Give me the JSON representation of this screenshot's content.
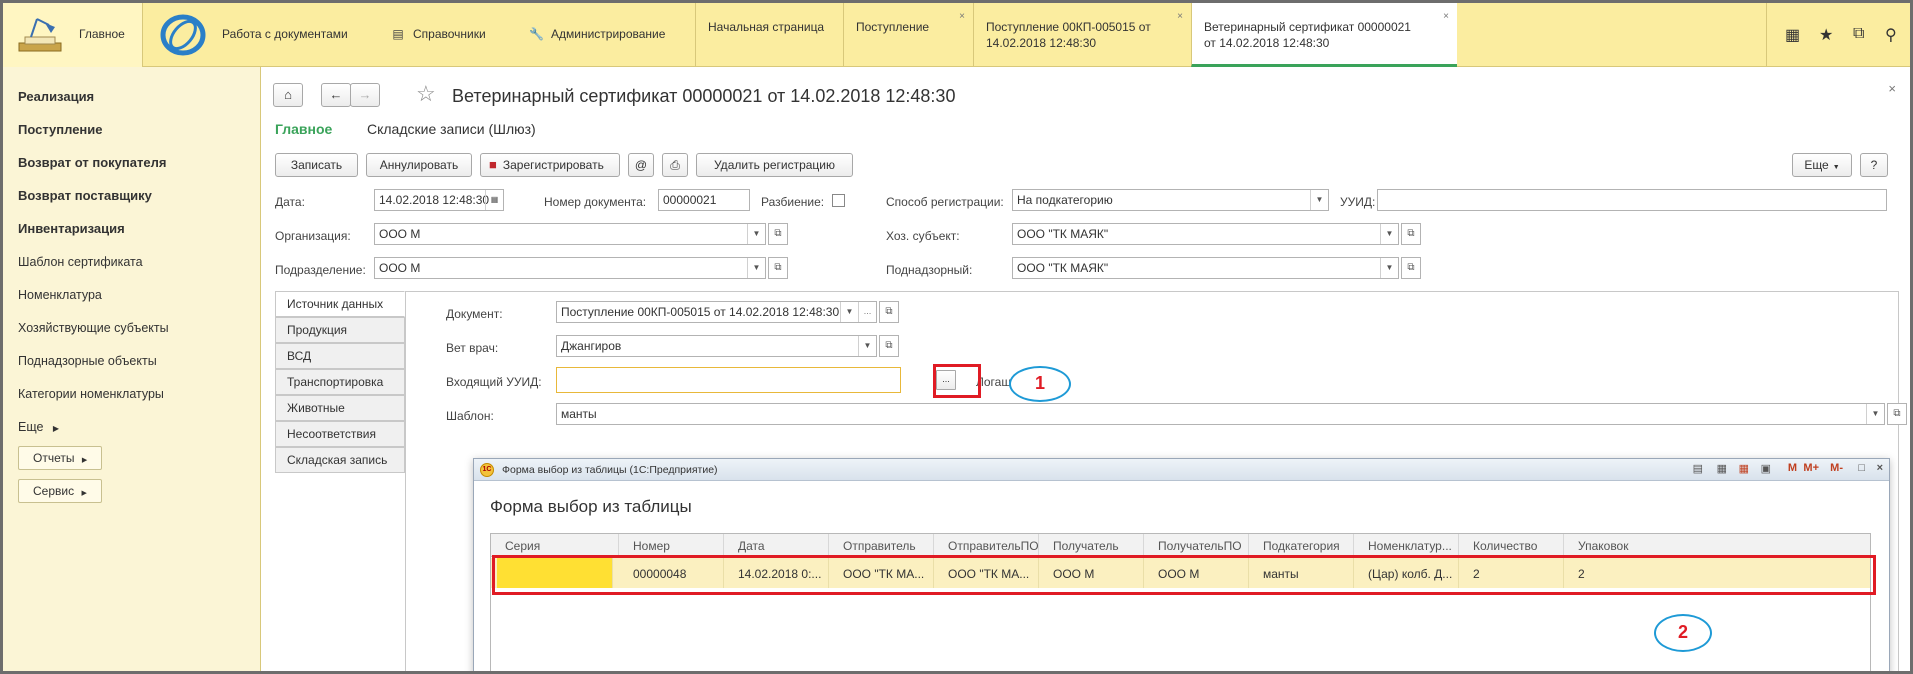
{
  "topbar": {
    "main_label": "Главное",
    "sections": [
      {
        "icon": "documents-icon",
        "label": "Работа с документами"
      },
      {
        "icon": "reference-icon",
        "label": "Справочники"
      },
      {
        "icon": "wrench-icon",
        "label": "Администрирование"
      }
    ],
    "tabs": [
      {
        "line1": "Начальная страница",
        "line2": "",
        "closable": false,
        "active": false
      },
      {
        "line1": "Поступление",
        "line2": "",
        "closable": true,
        "active": false
      },
      {
        "line1": "Поступление 00КП-005015 от",
        "line2": "14.02.2018 12:48:30",
        "closable": true,
        "active": false
      },
      {
        "line1": "Ветеринарный сертификат 00000021",
        "line2": "от 14.02.2018 12:48:30",
        "closable": true,
        "active": true
      }
    ],
    "close_glyph": "×",
    "icons": [
      "apps-icon",
      "star-icon",
      "history-icon",
      "search-icon"
    ]
  },
  "sidebar": {
    "bold_items": [
      "Реализация",
      "Поступление",
      "Возврат от покупателя",
      "Возврат поставщику",
      "Инвентаризация"
    ],
    "items": [
      "Шаблон сертификата",
      "Номенклатура",
      "Хозяйствующие субъекты",
      "Поднадзорные объекты",
      "Категории номенклатуры"
    ],
    "more": "Еще",
    "buttons": [
      "Отчеты",
      "Сервис"
    ]
  },
  "doc": {
    "title": "Ветеринарный сертификат 00000021 от 14.02.2018 12:48:30",
    "nav_main": "Главное",
    "nav_link": "Складские записи (Шлюз)",
    "toolbar": {
      "save": "Записать",
      "cancel": "Аннулировать",
      "register": "Зарегистрировать",
      "at": "@",
      "delete_reg": "Удалить регистрацию",
      "more": "Еще",
      "help": "?"
    },
    "fields": {
      "date_label": "Дата:",
      "date_value": "14.02.2018 12:48:30",
      "number_label": "Номер документа:",
      "number_value": "00000021",
      "split_label": "Разбиение:",
      "reg_method_label": "Способ регистрации:",
      "reg_method_value": "На подкатегорию",
      "uuid_label": "УУИД:",
      "uuid_value": "",
      "org_label": "Организация:",
      "org_value": "ООО М",
      "subject_label": "Хоз. субъект:",
      "subject_value": "ООО \"ТК МАЯК\"",
      "division_label": "Подразделение:",
      "division_value": "ООО М",
      "supervised_label": "Поднадзорный:",
      "supervised_value": "ООО \"ТК МАЯК\""
    },
    "vtabs": [
      "Источник данных",
      "Продукция",
      "ВСД",
      "Транспортировка",
      "Животные",
      "Несоответствия",
      "Складская запись"
    ],
    "source": {
      "document_label": "Документ:",
      "document_value": "Поступление 00КП-005015 от 14.02.2018 12:48:30",
      "vet_label": "Вет врач:",
      "vet_value": "Джангиров",
      "in_uuid_label": "Входящий УУИД:",
      "in_uuid_value": "",
      "select_glyph": "...",
      "extra_label": "Логаш",
      "template_label": "Шаблон:",
      "template_value": "манты"
    }
  },
  "modal": {
    "window_title": "Форма выбор из таблицы  (1С:Предприятие)",
    "heading": "Форма выбор из таблицы",
    "header_icons": [
      "M",
      "M+",
      "M-"
    ],
    "columns": [
      "Серия",
      "Номер",
      "Дата",
      "Отправитель",
      "ОтправительПО",
      "Получатель",
      "ПолучательПО",
      "Подкатегория",
      "Номенклатур...",
      "Количество",
      "Упаковок"
    ],
    "rows": [
      [
        "",
        "00000048",
        "14.02.2018 0:...",
        "ООО \"ТК МА...",
        "ООО \"ТК МА...",
        "ООО М",
        "ООО М",
        "манты",
        "(Цар) колб. Д...",
        "2",
        "2"
      ]
    ]
  },
  "annotations": {
    "marker1": "1",
    "marker2": "2"
  }
}
